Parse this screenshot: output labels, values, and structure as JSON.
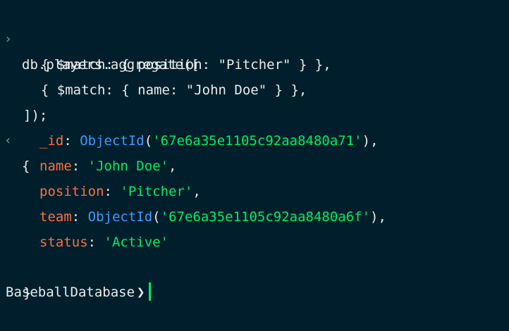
{
  "colors": {
    "background": "#001e2b",
    "text": "#e8edeb",
    "key": "#ff6f44",
    "function": "#3d9cff",
    "string": "#00ed64",
    "cursor": "#00ed64"
  },
  "icons": {
    "input_marker": "chevron-right-icon",
    "output_marker": "chevron-left-icon",
    "prompt_marker": "chevron-right-icon"
  },
  "input": {
    "marker": "›",
    "lines": [
      "db.players.aggregate([",
      "  { $match: { position: \"Pitcher\" } },",
      "  { $match: { name: \"John Doe\" } },",
      "]);"
    ]
  },
  "output": {
    "marker": "‹",
    "open": "{",
    "close": "}",
    "fields": [
      {
        "key": "_id",
        "sep": ": ",
        "fn": "ObjectId",
        "open_paren": "(",
        "value": "'67e6a35e1105c92aa8480a71'",
        "close_paren": ")",
        "comma": ","
      },
      {
        "key": "name",
        "sep": ": ",
        "value": "'John Doe'",
        "comma": ","
      },
      {
        "key": "position",
        "sep": ": ",
        "value": "'Pitcher'",
        "comma": ","
      },
      {
        "key": "team",
        "sep": ": ",
        "fn": "ObjectId",
        "open_paren": "(",
        "value": "'67e6a35e1105c92aa8480a6f'",
        "close_paren": ")",
        "comma": ","
      },
      {
        "key": "status",
        "sep": ": ",
        "value": "'Active'",
        "comma": ""
      }
    ]
  },
  "prompt": {
    "database": "BaseballDatabase",
    "arrow": "❯"
  }
}
